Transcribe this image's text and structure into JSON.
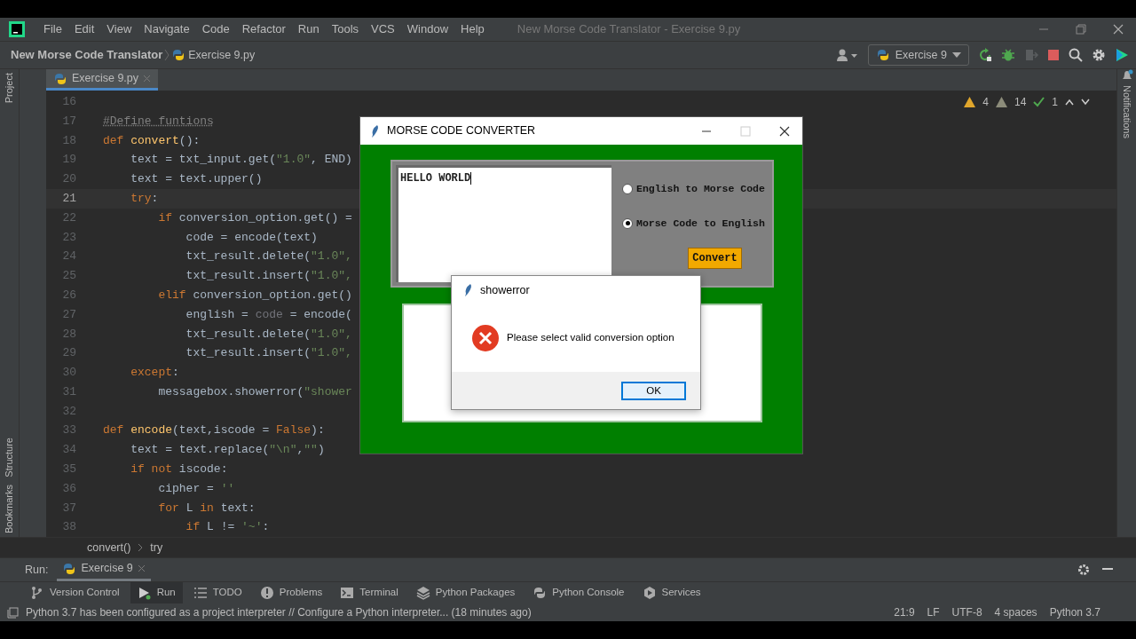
{
  "menu_bar": {
    "items": [
      "File",
      "Edit",
      "View",
      "Navigate",
      "Code",
      "Refactor",
      "Run",
      "Tools",
      "VCS",
      "Window",
      "Help"
    ],
    "title": "New Morse Code Translator - Exercise 9.py"
  },
  "navigation_bar": {
    "breadcrumb": [
      "New Morse Code Translator",
      "Exercise 9.py"
    ],
    "run_configuration": "Exercise 9"
  },
  "editor_tabs": [
    {
      "label": "Exercise 9.py",
      "selected": true
    }
  ],
  "left_stripe": {
    "top": [
      "Project"
    ],
    "bottom": [
      "Structure",
      "Bookmarks"
    ]
  },
  "right_stripe": [
    "Notifications"
  ],
  "inspections": {
    "warnings": "4",
    "weak_warnings": "14",
    "typos": "1"
  },
  "editor": {
    "lines": [
      {
        "number": "16",
        "current": false
      },
      {
        "number": "17",
        "current": false,
        "tokens": [
          {
            "t": "#Define funtions",
            "kind": "comment"
          }
        ]
      },
      {
        "number": "18",
        "current": false,
        "tokens": [
          {
            "t": "def ",
            "kind": "keyword"
          },
          {
            "t": "convert",
            "kind": "function"
          },
          {
            "t": "():",
            "kind": "plain"
          }
        ]
      },
      {
        "number": "19",
        "current": false,
        "tokens": [
          {
            "t": "    text = txt_input.get(",
            "kind": "plain"
          },
          {
            "t": "\"1.0\"",
            "kind": "string"
          },
          {
            "t": ", END)",
            "kind": "plain"
          }
        ]
      },
      {
        "number": "20",
        "current": false,
        "tokens": [
          {
            "t": "    text = text.upper()",
            "kind": "plain"
          }
        ]
      },
      {
        "number": "21",
        "current": true,
        "tokens": [
          {
            "t": "    try",
            "kind": "keyword"
          },
          {
            "t": ":",
            "kind": "plain"
          }
        ]
      },
      {
        "number": "22",
        "current": false,
        "tokens": [
          {
            "t": "        if ",
            "kind": "keyword"
          },
          {
            "t": "conversion_option.get() =",
            "kind": "plain"
          }
        ]
      },
      {
        "number": "23",
        "current": false,
        "tokens": [
          {
            "t": "            code = encode(text)",
            "kind": "plain"
          }
        ]
      },
      {
        "number": "24",
        "current": false,
        "tokens": [
          {
            "t": "            txt_result.delete(",
            "kind": "plain"
          },
          {
            "t": "\"1.0\",",
            "kind": "string"
          }
        ]
      },
      {
        "number": "25",
        "current": false,
        "tokens": [
          {
            "t": "            txt_result.insert(",
            "kind": "plain"
          },
          {
            "t": "\"1.0\",",
            "kind": "string"
          }
        ]
      },
      {
        "number": "26",
        "current": false,
        "tokens": [
          {
            "t": "        elif ",
            "kind": "keyword"
          },
          {
            "t": "conversion_option.get()",
            "kind": "plain"
          }
        ]
      },
      {
        "number": "27",
        "current": false,
        "tokens": [
          {
            "t": "            english = ",
            "kind": "plain"
          },
          {
            "t": "code",
            "kind": "unused"
          },
          {
            "t": " = encode(",
            "kind": "plain"
          }
        ]
      },
      {
        "number": "28",
        "current": false,
        "tokens": [
          {
            "t": "            txt_result.delete(",
            "kind": "plain"
          },
          {
            "t": "\"1.0\",",
            "kind": "string"
          }
        ]
      },
      {
        "number": "29",
        "current": false,
        "tokens": [
          {
            "t": "            txt_result.insert(",
            "kind": "plain"
          },
          {
            "t": "\"1.0\",",
            "kind": "string"
          }
        ]
      },
      {
        "number": "30",
        "current": false,
        "tokens": [
          {
            "t": "    except",
            "kind": "keyword"
          },
          {
            "t": ":",
            "kind": "plain"
          }
        ]
      },
      {
        "number": "31",
        "current": false,
        "tokens": [
          {
            "t": "        messagebox.showerror(",
            "kind": "plain"
          },
          {
            "t": "\"shower",
            "kind": "string"
          }
        ]
      },
      {
        "number": "32",
        "current": false
      },
      {
        "number": "33",
        "current": false,
        "tokens": [
          {
            "t": "def ",
            "kind": "keyword"
          },
          {
            "t": "encode",
            "kind": "function"
          },
          {
            "t": "(text,iscode = ",
            "kind": "plain"
          },
          {
            "t": "False",
            "kind": "keyword"
          },
          {
            "t": "):",
            "kind": "plain"
          }
        ]
      },
      {
        "number": "34",
        "current": false,
        "tokens": [
          {
            "t": "    text = text.replace(",
            "kind": "plain"
          },
          {
            "t": "\"\\n\"",
            "kind": "string"
          },
          {
            "t": ",",
            "kind": "plain"
          },
          {
            "t": "\"\"",
            "kind": "string"
          },
          {
            "t": ")",
            "kind": "plain"
          }
        ]
      },
      {
        "number": "35",
        "current": false,
        "tokens": [
          {
            "t": "    if not ",
            "kind": "keyword"
          },
          {
            "t": "iscode:",
            "kind": "plain"
          }
        ]
      },
      {
        "number": "36",
        "current": false,
        "tokens": [
          {
            "t": "        cipher = ",
            "kind": "plain"
          },
          {
            "t": "''",
            "kind": "string"
          }
        ]
      },
      {
        "number": "37",
        "current": false,
        "tokens": [
          {
            "t": "        for ",
            "kind": "keyword"
          },
          {
            "t": "L ",
            "kind": "plain"
          },
          {
            "t": "in ",
            "kind": "keyword"
          },
          {
            "t": "text:",
            "kind": "plain"
          }
        ]
      },
      {
        "number": "38",
        "current": false,
        "tokens": [
          {
            "t": "            if ",
            "kind": "keyword"
          },
          {
            "t": "L != ",
            "kind": "plain"
          },
          {
            "t": "'~'",
            "kind": "string"
          },
          {
            "t": ":",
            "kind": "plain"
          }
        ]
      }
    ]
  },
  "editor_breadcrumb": [
    "convert()",
    "try"
  ],
  "run_panel": {
    "label": "Run:",
    "tabs": [
      {
        "label": "Exercise 9",
        "selected": true
      }
    ]
  },
  "tool_window_bar": [
    {
      "label": "Version Control",
      "kind": "branch",
      "selected": false
    },
    {
      "label": "Run",
      "kind": "run",
      "selected": true
    },
    {
      "label": "TODO",
      "kind": "list",
      "selected": false
    },
    {
      "label": "Problems",
      "kind": "problems",
      "selected": false
    },
    {
      "label": "Terminal",
      "kind": "terminal",
      "selected": false
    },
    {
      "label": "Python Packages",
      "kind": "layers",
      "selected": false
    },
    {
      "label": "Python Console",
      "kind": "python",
      "selected": false
    },
    {
      "label": "Services",
      "kind": "services",
      "selected": false
    }
  ],
  "status_bar": {
    "message": "Python 3.7 has been configured as a project interpreter // Configure a Python interpreter... (18 minutes ago)",
    "items": [
      "21:9",
      "LF",
      "UTF-8",
      "4 spaces",
      "Python 3.7"
    ]
  },
  "tk_window": {
    "title": "MORSE CODE CONVERTER",
    "input_value": "HELLO WORLD",
    "options": [
      {
        "label": "English to Morse Code",
        "selected": false
      },
      {
        "label": "Morse Code to English",
        "selected": true
      }
    ],
    "button": "Convert"
  },
  "error_dialog": {
    "title": "showerror",
    "message": "Please select valid conversion option",
    "button": "OK"
  }
}
